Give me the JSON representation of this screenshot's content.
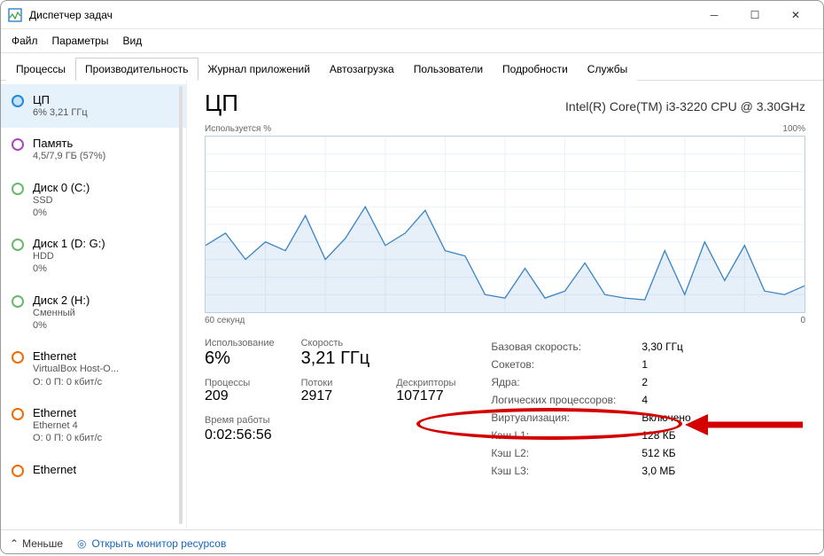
{
  "window": {
    "title": "Диспетчер задач"
  },
  "menu": [
    "Файл",
    "Параметры",
    "Вид"
  ],
  "tabs": [
    "Процессы",
    "Производительность",
    "Журнал приложений",
    "Автозагрузка",
    "Пользователи",
    "Подробности",
    "Службы"
  ],
  "active_tab": 1,
  "sidebar": {
    "items": [
      {
        "name": "ЦП",
        "meta": "6% 3,21 ГГц",
        "kind": "cpu",
        "selected": true
      },
      {
        "name": "Память",
        "meta": "4,5/7,9 ГБ (57%)",
        "kind": "mem"
      },
      {
        "name": "Диск 0 (C:)",
        "meta": "SSD\n0%",
        "kind": "disk"
      },
      {
        "name": "Диск 1 (D: G:)",
        "meta": "HDD\n0%",
        "kind": "disk"
      },
      {
        "name": "Диск 2 (H:)",
        "meta": "Сменный\n0%",
        "kind": "disk"
      },
      {
        "name": "Ethernet",
        "meta": "VirtualBox Host-O...\nО: 0 П: 0 кбит/с",
        "kind": "eth"
      },
      {
        "name": "Ethernet",
        "meta": "Ethernet 4\nО: 0 П: 0 кбит/с",
        "kind": "eth"
      },
      {
        "name": "Ethernet",
        "meta": "",
        "kind": "eth"
      }
    ]
  },
  "main": {
    "heading": "ЦП",
    "cpu_model": "Intel(R) Core(TM) i3-3220 CPU @ 3.30GHz",
    "chart_top_left": "Используется %",
    "chart_top_right": "100%",
    "chart_bottom_left": "60 секунд",
    "chart_bottom_right": "0",
    "stats_left": [
      {
        "lbl": "Использование",
        "val": "6%"
      },
      {
        "lbl": "Скорость",
        "val": "3,21 ГГц"
      },
      {
        "lbl": "",
        "val": ""
      },
      {
        "lbl": "Процессы",
        "val": "209"
      },
      {
        "lbl": "Потоки",
        "val": "2917"
      },
      {
        "lbl": "Дескрипторы",
        "val": "107177"
      }
    ],
    "uptime": {
      "lbl": "Время работы",
      "val": "0:02:56:56"
    },
    "stats_right": [
      {
        "k": "Базовая скорость:",
        "v": "3,30 ГГц"
      },
      {
        "k": "Сокетов:",
        "v": "1"
      },
      {
        "k": "Ядра:",
        "v": "2"
      },
      {
        "k": "Логических процессоров:",
        "v": "4"
      },
      {
        "k": "Виртуализация:",
        "v": "Включено"
      },
      {
        "k": "Кэш L1:",
        "v": "128 КБ"
      },
      {
        "k": "Кэш L2:",
        "v": "512 КБ"
      },
      {
        "k": "Кэш L3:",
        "v": "3,0 МБ"
      }
    ]
  },
  "footer": {
    "less": "Меньше",
    "rmon": "Открыть монитор ресурсов"
  },
  "chart_data": {
    "type": "line",
    "title": "Используется %",
    "xlabel": "60 секунд",
    "ylabel": "%",
    "ylim": [
      0,
      100
    ],
    "x_seconds_ago": [
      60,
      58,
      56,
      54,
      52,
      50,
      48,
      46,
      44,
      42,
      40,
      38,
      36,
      34,
      32,
      30,
      28,
      26,
      24,
      22,
      20,
      18,
      16,
      14,
      12,
      10,
      8,
      6,
      4,
      2,
      0
    ],
    "values": [
      38,
      45,
      30,
      40,
      35,
      55,
      30,
      42,
      60,
      38,
      45,
      58,
      35,
      32,
      10,
      8,
      25,
      8,
      12,
      28,
      10,
      8,
      7,
      35,
      10,
      40,
      18,
      38,
      12,
      10,
      15
    ]
  }
}
